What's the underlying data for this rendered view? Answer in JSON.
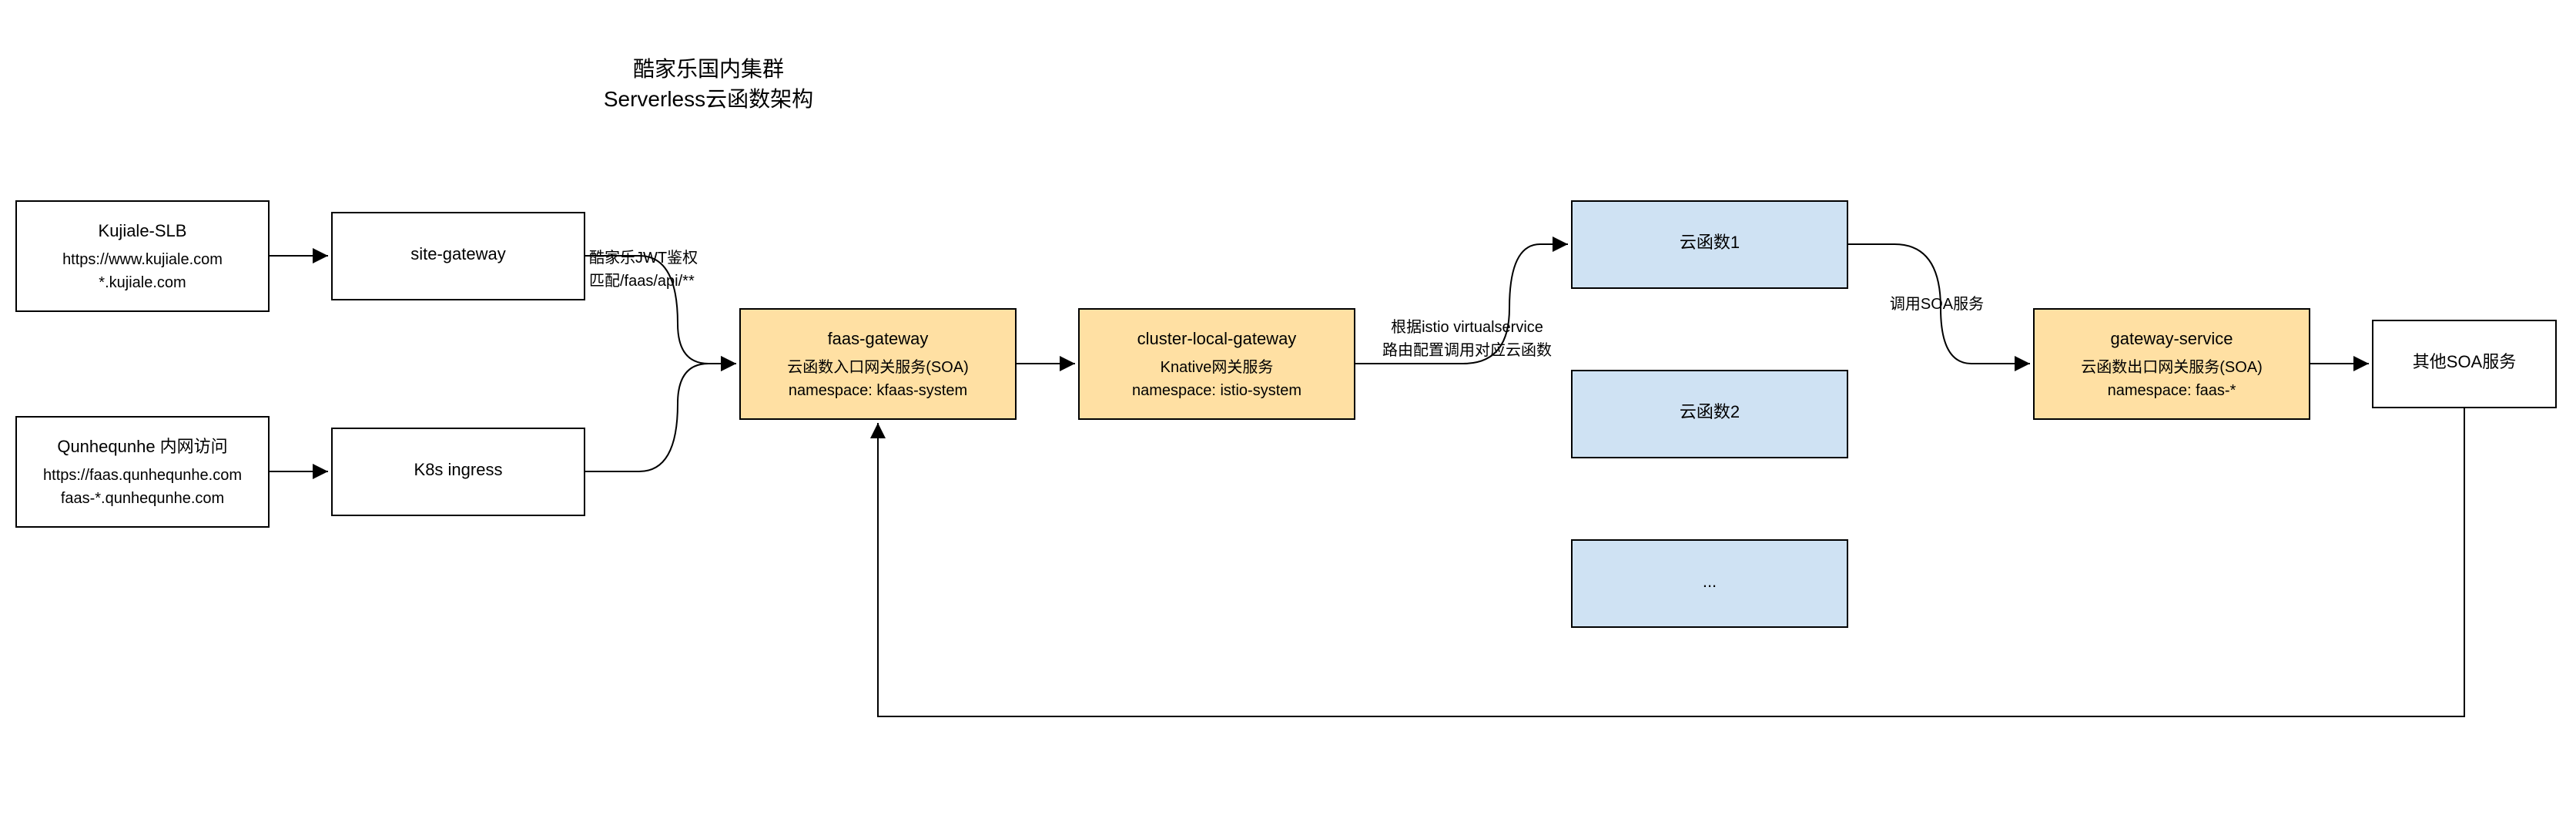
{
  "title": {
    "line1": "酷家乐国内集群",
    "line2": "Serverless云函数架构"
  },
  "nodes": {
    "kujiale_slb": {
      "title": "Kujiale-SLB",
      "line2": "https://www.kujiale.com",
      "line3": "*.kujiale.com"
    },
    "qunhe": {
      "title": "Qunhequnhe 内网访问",
      "line2": "https://faas.qunhequnhe.com",
      "line3": "faas-*.qunhequnhe.com"
    },
    "site_gateway": {
      "title": "site-gateway"
    },
    "k8s_ingress": {
      "title": "K8s ingress"
    },
    "faas_gateway": {
      "title": "faas-gateway",
      "line2": "云函数入口网关服务(SOA)",
      "line3": "namespace: kfaas-system"
    },
    "cluster_local": {
      "title": "cluster-local-gateway",
      "line2": "Knative网关服务",
      "line3": "namespace: istio-system"
    },
    "fn1": {
      "title": "云函数1"
    },
    "fn2": {
      "title": "云函数2"
    },
    "fn3": {
      "title": "..."
    },
    "gateway_service": {
      "title": "gateway-service",
      "line2": "云函数出口网关服务(SOA)",
      "line3": "namespace: faas-*"
    },
    "other_soa": {
      "title": "其他SOA服务"
    }
  },
  "edges": {
    "jwt": {
      "line1": "酷家乐JWT鉴权",
      "line2": "匹配/faas/api/**"
    },
    "istio": {
      "line1": "根据istio virtualservice",
      "line2": "路由配置调用对应云函数"
    },
    "soa": {
      "line1": "调用SOA服务"
    }
  }
}
